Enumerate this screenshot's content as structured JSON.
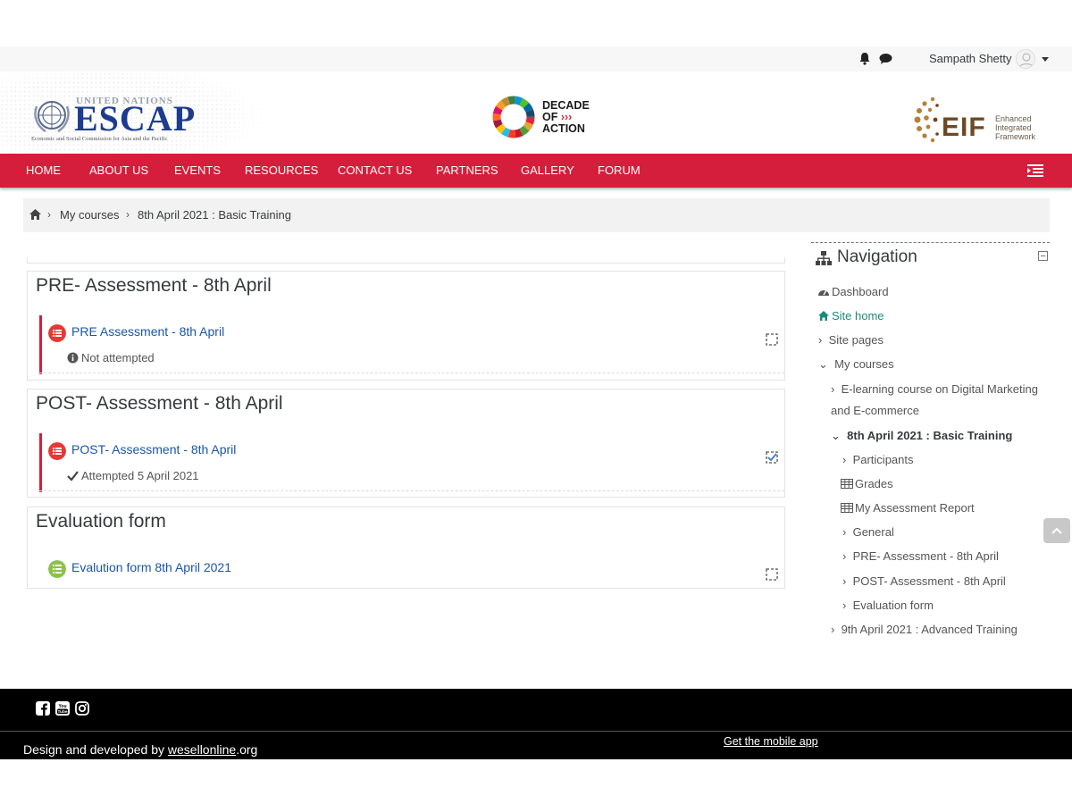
{
  "topbar": {
    "username": "Sampath Shetty",
    "icons": [
      "bell-icon",
      "chat-icon",
      "avatar",
      "caret-down-icon"
    ]
  },
  "banner": {
    "escap": {
      "org": "UNITED NATIONS",
      "name": "ESCAP",
      "subtitle": "Economic and Social Commission for Asia and the Pacific"
    },
    "decade": {
      "line1": "DECADE",
      "line2": "OF",
      "line3": "ACTION"
    },
    "eif": {
      "name": "EIF",
      "tag1": "Enhanced",
      "tag2": "Integrated",
      "tag3": "Framework"
    }
  },
  "navbar": {
    "items": [
      "HOME",
      "ABOUT US",
      "EVENTS",
      "RESOURCES",
      "CONTACT US",
      "PARTNERS",
      "GALLERY",
      "FORUM"
    ],
    "color": "#d51e3b"
  },
  "breadcrumb": {
    "items": [
      "My courses",
      "8th April 2021 : Basic Training"
    ]
  },
  "sections": [
    {
      "title": "PRE- Assessment - 8th April",
      "activity": "PRE Assessment - 8th April",
      "status": "Not attempted",
      "status_icon": "info-icon",
      "completed": false
    },
    {
      "title": "POST- Assessment - 8th April",
      "activity": "POST- Assessment - 8th April",
      "status": "Attempted 5 April 2021",
      "status_icon": "checkmark-icon",
      "completed": true
    },
    {
      "title": "Evaluation form",
      "activity": "Evalution form 8th April 2021",
      "status": "",
      "completed": false
    }
  ],
  "navigation": {
    "title": "Navigation",
    "items": {
      "dashboard": "Dashboard",
      "site_home": "Site home",
      "site_pages": "Site pages",
      "my_courses": "My courses",
      "course1_line1": "E-learning course on Digital Marketing",
      "course1_line2": "and E-commerce",
      "course2": "8th April 2021 : Basic Training",
      "participants": "Participants",
      "grades": "Grades",
      "report": "My Assessment Report",
      "general": "General",
      "pre": "PRE- Assessment - 8th April",
      "post": "POST- Assessment - 8th April",
      "eval": "Evaluation form",
      "course3": "9th April 2021 : Advanced Training"
    }
  },
  "footer": {
    "social": [
      "facebook-icon",
      "youtube-icon",
      "instagram-icon"
    ],
    "credit_prefix": "Design and developed by ",
    "credit_link": "wesellonline",
    "credit_suffix": ".org",
    "mobile_app": "Get the mobile app"
  }
}
